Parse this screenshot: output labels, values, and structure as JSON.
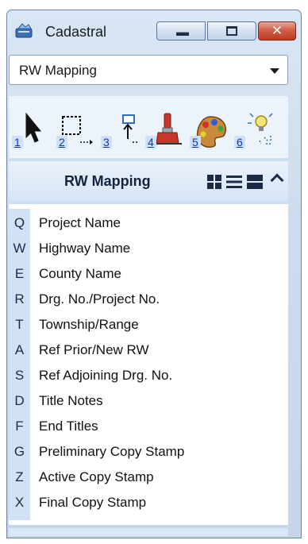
{
  "window": {
    "title": "Cadastral",
    "close_glyph": "✕"
  },
  "dropdown": {
    "selected": "RW Mapping"
  },
  "toolbar": {
    "tools": [
      {
        "num": "1",
        "icon": "select-arrow-icon"
      },
      {
        "num": "2",
        "icon": "fence-block-icon"
      },
      {
        "num": "3",
        "icon": "place-element-icon"
      },
      {
        "num": "4",
        "icon": "paint-brush-icon"
      },
      {
        "num": "5",
        "icon": "palette-icon"
      },
      {
        "num": "6",
        "icon": "lightbulb-icon"
      }
    ]
  },
  "section": {
    "title": "RW Mapping"
  },
  "items": [
    {
      "key": "Q",
      "label": "Project Name"
    },
    {
      "key": "W",
      "label": "Highway Name"
    },
    {
      "key": "E",
      "label": "County Name"
    },
    {
      "key": "R",
      "label": "Drg. No./Project No."
    },
    {
      "key": "T",
      "label": "Township/Range"
    },
    {
      "key": "A",
      "label": "Ref Prior/New RW"
    },
    {
      "key": "S",
      "label": "Ref Adjoining Drg. No."
    },
    {
      "key": "D",
      "label": "Title Notes"
    },
    {
      "key": "F",
      "label": "End Titles"
    },
    {
      "key": "G",
      "label": "Preliminary Copy Stamp"
    },
    {
      "key": "Z",
      "label": "Active Copy Stamp"
    },
    {
      "key": "X",
      "label": "Final Copy Stamp"
    }
  ],
  "colors": {
    "accent": "#d1e2f7",
    "close": "#c03a22",
    "number_link": "#0b36c2"
  }
}
